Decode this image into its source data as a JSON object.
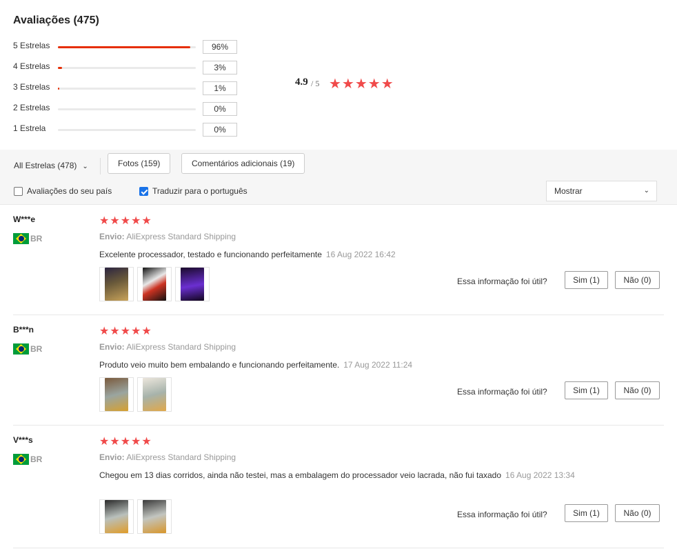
{
  "header": {
    "title": "Avaliações (475)"
  },
  "distribution": [
    {
      "label": "5 Estrelas",
      "percent": "96%",
      "fraction": 0.96
    },
    {
      "label": "4 Estrelas",
      "percent": "3%",
      "fraction": 0.03
    },
    {
      "label": "3 Estrelas",
      "percent": "1%",
      "fraction": 0.01
    },
    {
      "label": "2 Estrelas",
      "percent": "0%",
      "fraction": 0
    },
    {
      "label": "1 Estrela",
      "percent": "0%",
      "fraction": 0
    }
  ],
  "summary": {
    "average": "4.9",
    "max": "/ 5",
    "stars": "★★★★★"
  },
  "filters": {
    "all_stars": "All Estrelas (478)",
    "photos": "Fotos (159)",
    "additional": "Comentários adicionais (19)",
    "country_checkbox": "Avaliações do seu país",
    "country_checked": false,
    "translate_checkbox": "Traduzir para o português",
    "translate_checked": true,
    "sort_label": "Mostrar"
  },
  "reviews": [
    {
      "name": "W***e",
      "country": "BR",
      "stars": "★★★★★",
      "shipping_label": "Envio:",
      "shipping": "AliExpress Standard Shipping",
      "text": "Excelente processador, testado e funcionando perfeitamente",
      "date": "16 Aug 2022 16:42",
      "photos": [
        "photo-1",
        "photo-2",
        "photo-3"
      ],
      "helpful": "Essa informação foi útil?",
      "yes": "Sim (1)",
      "no": "Não (0)"
    },
    {
      "name": "B***n",
      "country": "BR",
      "stars": "★★★★★",
      "shipping_label": "Envio:",
      "shipping": "AliExpress Standard Shipping",
      "text": "Produto veio muito bem embalando e funcionando perfeitamente.",
      "date": "17 Aug 2022 11:24",
      "photos": [
        "photo-1",
        "photo-2"
      ],
      "helpful": "Essa informação foi útil?",
      "yes": "Sim (1)",
      "no": "Não (0)"
    },
    {
      "name": "V***s",
      "country": "BR",
      "stars": "★★★★★",
      "shipping_label": "Envio:",
      "shipping": "AliExpress Standard Shipping",
      "text": "Chegou em 13 dias corridos, ainda não testei, mas a embalagem do processador veio lacrada, não fui taxado",
      "date": "16 Aug 2022 13:34",
      "photos": [
        "photo-1",
        "photo-2"
      ],
      "helpful": "Essa informação foi útil?",
      "yes": "Sim (1)",
      "no": "Não (0)"
    }
  ]
}
